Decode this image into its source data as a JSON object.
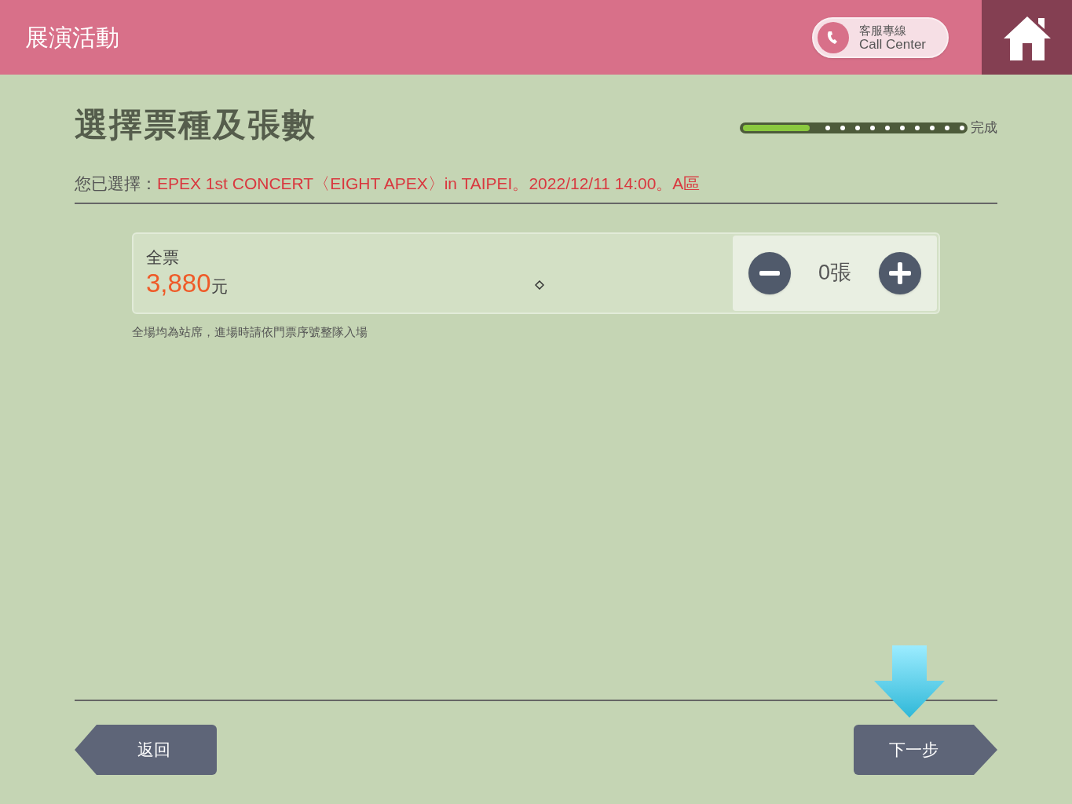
{
  "header": {
    "title": "展演活動",
    "call_center": {
      "line1": "客服專線",
      "line2": "Call Center"
    }
  },
  "page_title": "選擇票種及張數",
  "progress": {
    "level": 0.3,
    "label": "完成"
  },
  "selection": {
    "label": "您已選擇：",
    "value": "EPEX 1st CONCERT〈EIGHT APEX〉in TAIPEI。2022/12/11 14:00。A區"
  },
  "tickets": [
    {
      "name": "全票",
      "price": "3,880",
      "currency": "元",
      "quantity": "0張"
    }
  ],
  "note": "全場均為站席，進場時請依門票序號整隊入場",
  "buttons": {
    "back": "返回",
    "next": "下一步"
  }
}
